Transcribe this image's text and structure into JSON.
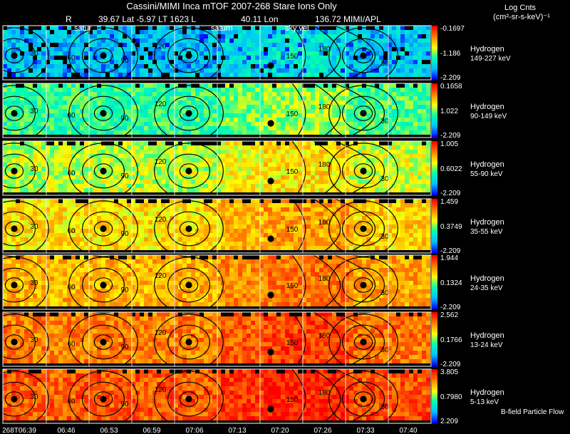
{
  "header": {
    "line1": "Cassini/MIMI Inca mTOF  2007-268   Stare    Ions Only",
    "line2_parts": [
      "R",
      "39.67 Lat -5.97 LT 1623 L",
      "40.11 Lon",
      "136.72  MIMI/APL"
    ],
    "column_marks": [
      "satur",
      "saturn",
      "sky vel"
    ],
    "colorbar_title": "Log Cnts",
    "colorbar_units": "(cm²-sr-s-keV)⁻¹"
  },
  "footer": {
    "time_labels": [
      "268T06:39",
      "06:46",
      "06:53",
      "06:59",
      "07:06",
      "07:13",
      "07:20",
      "07:26",
      "07:33",
      "07:40"
    ],
    "note": "B-field Particle Flow"
  },
  "contour_labels": [
    "30",
    "60",
    "90",
    "120",
    "150",
    "180"
  ],
  "panels": [
    {
      "species": "Hydrogen",
      "energy": "149-227 keV",
      "max": "-0.1697",
      "mid": "-1.186",
      "min": "-2.209"
    },
    {
      "species": "Hydrogen",
      "energy": "90-149 keV",
      "max": "0.1658",
      "mid": "1.022",
      "min": "-2.209"
    },
    {
      "species": "Hydrogen",
      "energy": "55-90 keV",
      "max": "1.005",
      "mid": "0.6022",
      "min": "-2.209"
    },
    {
      "species": "Hydrogen",
      "energy": "35-55 keV",
      "max": "1.459",
      "mid": "0.3749",
      "min": "-2.209"
    },
    {
      "species": "Hydrogen",
      "energy": "24-35 keV",
      "max": "1.944",
      "mid": "0.1324",
      "min": "-2.209"
    },
    {
      "species": "Hydrogen",
      "energy": "13-24 keV",
      "max": "2.562",
      "mid": "0.1766",
      "min": "-2.209"
    },
    {
      "species": "Hydrogen",
      "energy": "5-13 keV",
      "max": "3.805",
      "mid": "0.7980",
      "min": "2.209"
    }
  ],
  "chart_data": {
    "type": "heatmap",
    "title": "Cassini/MIMI Inca mTOF  2007-268   Stare    Ions Only",
    "x_tick_labels": [
      "268T06:39",
      "06:46",
      "06:53",
      "06:59",
      "07:06",
      "07:13",
      "07:20",
      "07:26",
      "07:33",
      "07:40"
    ],
    "colorbar_label": "Log Cnts (cm²-sr-s-keV)⁻¹",
    "colormap": [
      "#0000ff",
      "#00c0ff",
      "#00ffb0",
      "#ffff00",
      "#ff8000",
      "#ff0000"
    ],
    "series": [
      {
        "name": "Hydrogen 149-227 keV",
        "colorbar_range": [
          -2.209,
          -0.1697
        ]
      },
      {
        "name": "Hydrogen 90-149 keV",
        "colorbar_range": [
          -2.209,
          0.1658
        ]
      },
      {
        "name": "Hydrogen 55-90 keV",
        "colorbar_range": [
          -2.209,
          1.005
        ]
      },
      {
        "name": "Hydrogen 35-55 keV",
        "colorbar_range": [
          -2.209,
          1.459
        ]
      },
      {
        "name": "Hydrogen 24-35 keV",
        "colorbar_range": [
          -2.209,
          1.944
        ]
      },
      {
        "name": "Hydrogen 13-24 keV",
        "colorbar_range": [
          -2.209,
          2.562
        ]
      },
      {
        "name": "Hydrogen 5-13 keV",
        "colorbar_range": [
          2.209,
          3.805
        ]
      }
    ]
  }
}
